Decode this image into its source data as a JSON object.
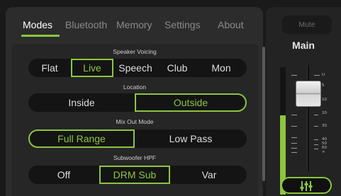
{
  "tabs": [
    {
      "label": "Modes",
      "active": true
    },
    {
      "label": "Bluetooth",
      "active": false
    },
    {
      "label": "Memory",
      "active": false
    },
    {
      "label": "Settings",
      "active": false
    },
    {
      "label": "About",
      "active": false
    }
  ],
  "sections": {
    "speaker_voicing": {
      "label": "Speaker Voicing",
      "options": [
        "Flat",
        "Live",
        "Speech",
        "Club",
        "Mon"
      ],
      "selected": "Live"
    },
    "location": {
      "label": "Location",
      "options": [
        "Inside",
        "Outside"
      ],
      "selected": "Outside"
    },
    "mix_out_mode": {
      "label": "Mix Out Mode",
      "options": [
        "Full Range",
        "Low Pass"
      ],
      "selected": "Full Range"
    },
    "subwoofer_hpf": {
      "label": "Subwoofer HPF",
      "options": [
        "Off",
        "DRM Sub",
        "Var"
      ],
      "selected": "DRM Sub"
    }
  },
  "channel": {
    "mute_label": "Mute",
    "name": "Main",
    "scale_labels": [
      "U",
      "5",
      "10",
      "20",
      "30",
      "40",
      "50",
      "60",
      "∞"
    ],
    "mixer_icon": "mixer-sliders-icon"
  },
  "colors": {
    "accent": "#8bc53f",
    "panel": "#2c2c2c",
    "segment_bg": "#141414"
  }
}
